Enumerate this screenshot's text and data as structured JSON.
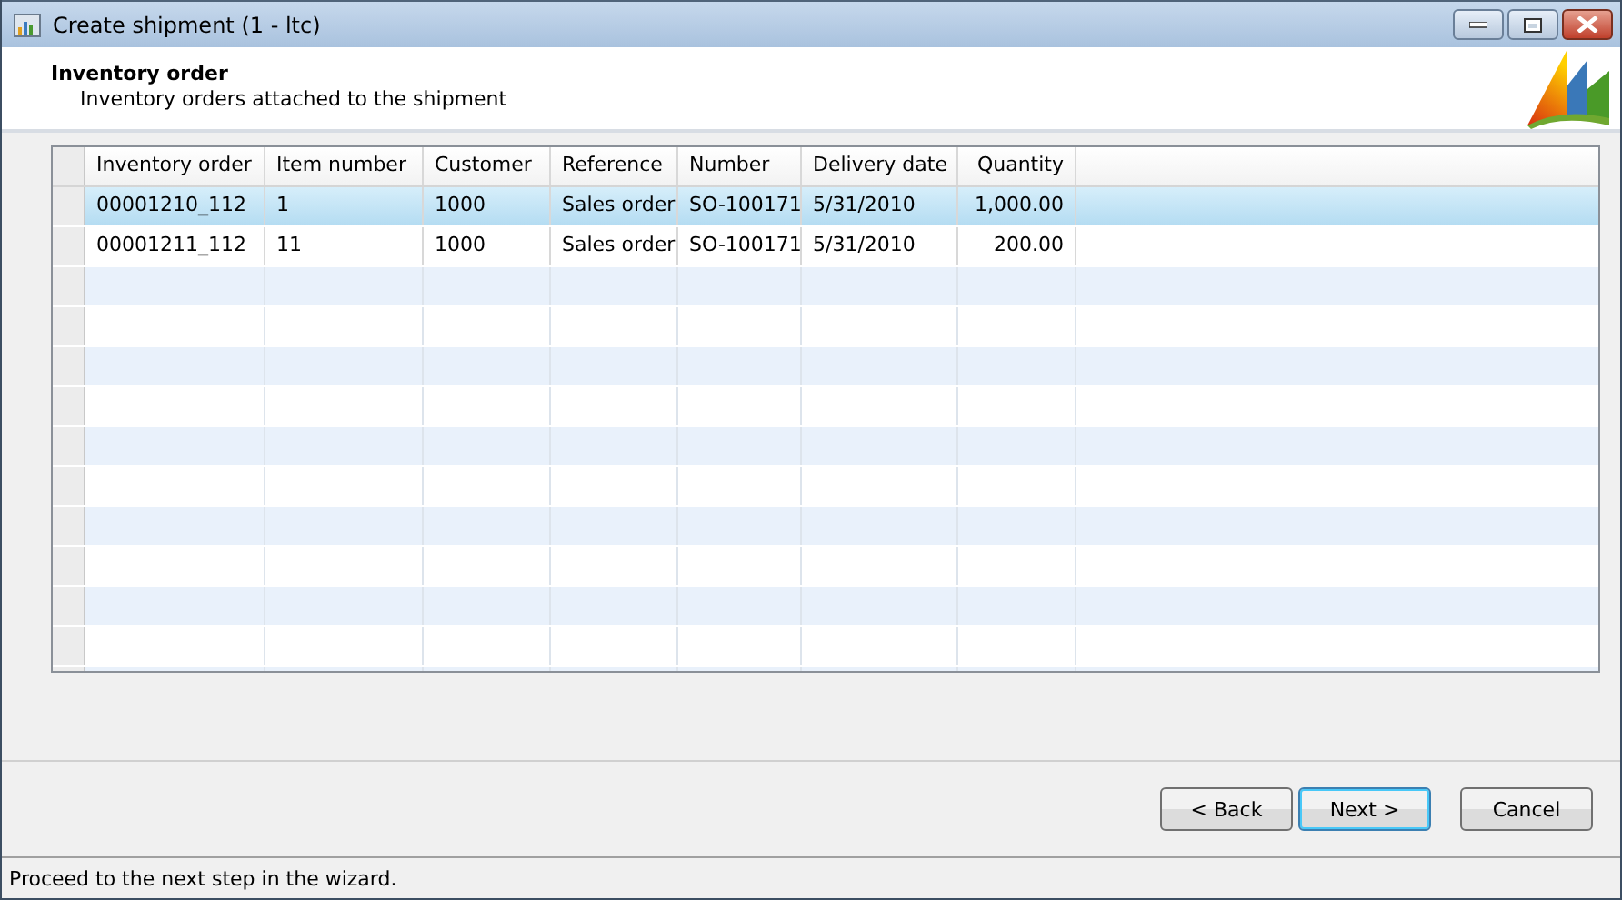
{
  "window": {
    "title": "Create shipment (1 - ltc)"
  },
  "header": {
    "title": "Inventory order",
    "subtitle": "Inventory orders attached to the shipment"
  },
  "table": {
    "columns": [
      "Inventory order",
      "Item number",
      "Customer",
      "Reference",
      "Number",
      "Delivery date",
      "Quantity"
    ],
    "rows": [
      {
        "selected": true,
        "cells": [
          "00001210_112",
          "1",
          "1000",
          "Sales order",
          "SO-100171",
          "5/31/2010",
          "1,000.00"
        ]
      },
      {
        "selected": false,
        "cells": [
          "00001211_112",
          "11",
          "1000",
          "Sales order",
          "SO-100171",
          "5/31/2010",
          "200.00"
        ]
      }
    ]
  },
  "buttons": [
    {
      "label": "< Back",
      "default": false
    },
    {
      "label": "Next >",
      "default": true
    },
    {
      "label": "Cancel",
      "default": false
    }
  ],
  "status_bar": "Proceed to the next step in the wizard."
}
